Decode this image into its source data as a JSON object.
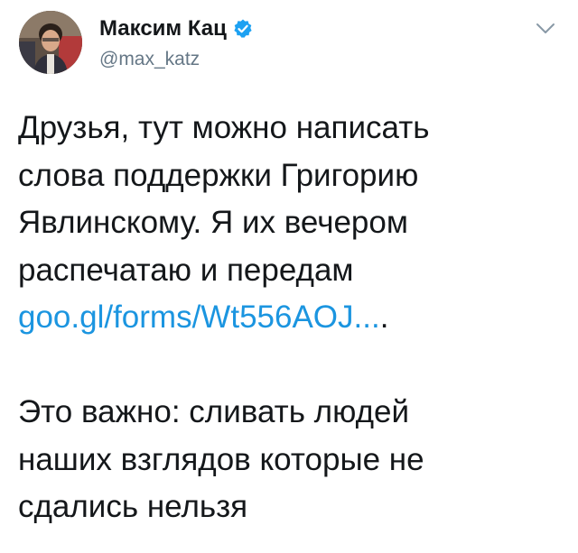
{
  "author": {
    "display_name": "Максим Кац",
    "handle": "@max_katz",
    "verified": true
  },
  "icons": {
    "verified": "verified-badge-icon",
    "menu": "chevron-down-icon"
  },
  "tweet": {
    "lines": [
      "Друзья, тут можно написать",
      "слова поддержки Григорию",
      "Явлинскому. Я их вечером",
      "распечатаю и передам"
    ],
    "link_text": "goo.gl/forms/Wt556AOJ...",
    "link_suffix": ".",
    "paragraph2_lines": [
      "Это важно: сливать людей",
      "наших взглядов которые не",
      "сдались нельзя"
    ]
  },
  "colors": {
    "text": "#14171a",
    "secondary": "#657786",
    "link": "#1b95e0",
    "verified": "#1da1f2"
  }
}
